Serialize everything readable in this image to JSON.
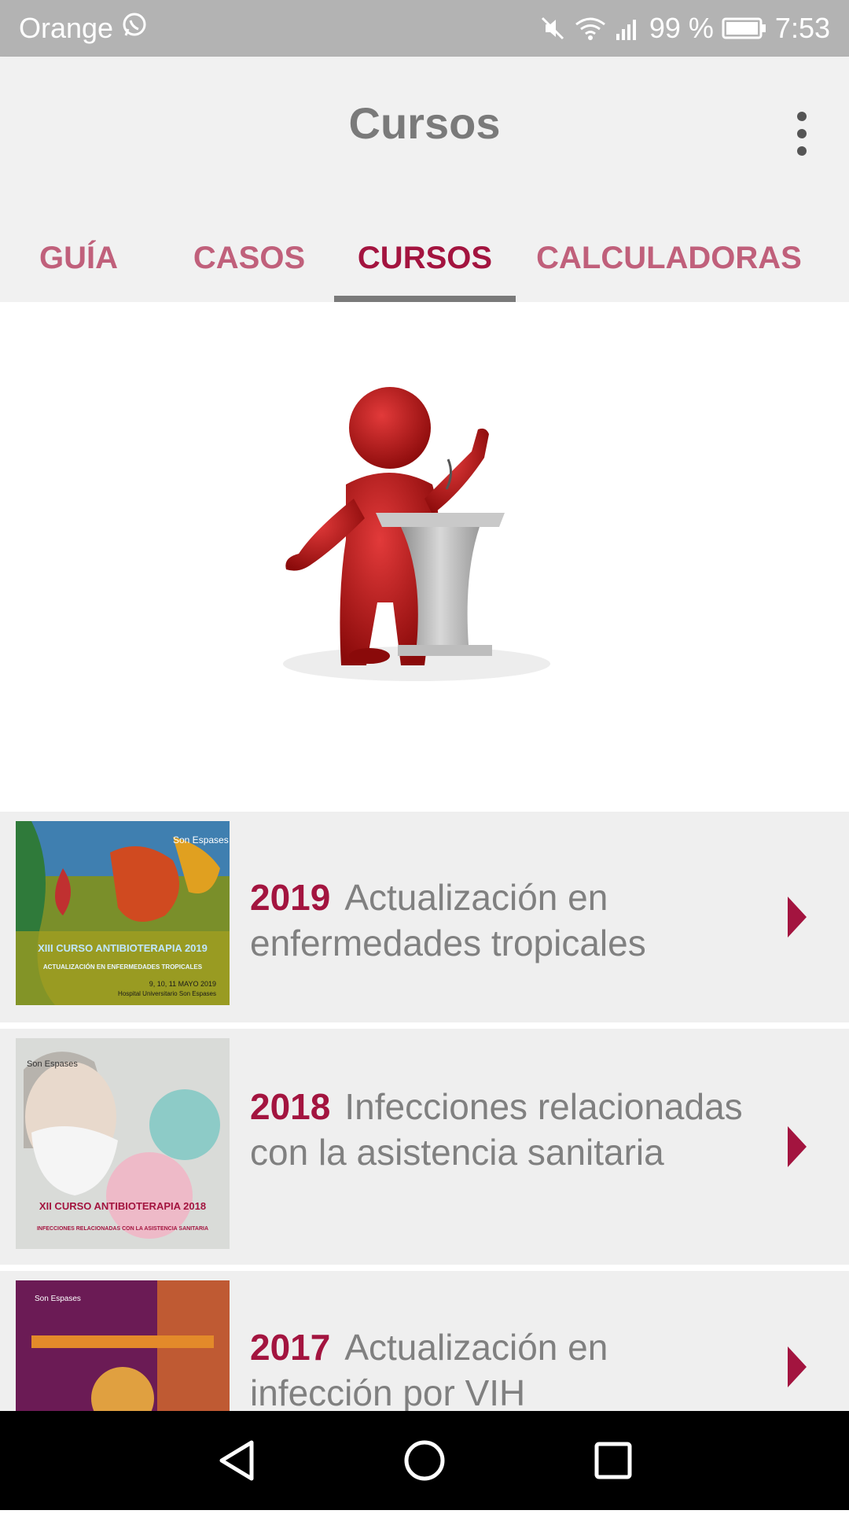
{
  "status_bar": {
    "carrier": "Orange",
    "battery": "99 %",
    "time": "7:53",
    "icons": [
      "whatsapp-icon",
      "mute-icon",
      "wifi-icon",
      "signal-icon",
      "battery-icon"
    ]
  },
  "app_bar": {
    "title": "Cursos",
    "menu_icon": "more-vert-icon"
  },
  "tabs": [
    {
      "label": "GUÍA",
      "active": false
    },
    {
      "label": "CASOS",
      "active": false
    },
    {
      "label": "CURSOS",
      "active": true
    },
    {
      "label": "CALCULADORAS",
      "active": false
    }
  ],
  "hero": {
    "icon": "presenter-at-podium-illustration"
  },
  "courses": [
    {
      "year": "2019",
      "title": "Actualización en enfermedades tropicales",
      "poster": {
        "brand": "Son Espases",
        "heading": "XIII CURSO ANTIBIOTERAPIA 2019",
        "subheading": "ACTUALIZACIÓN EN ENFERMEDADES TROPICALES",
        "dates": "9, 10, 11 MAYO 2019",
        "venue": "Hospital Universitario Son Espases"
      }
    },
    {
      "year": "2018",
      "title": "Infecciones relacionadas con la asistencia sanitaria",
      "poster": {
        "brand": "Son Espases",
        "heading": "XII CURSO ANTIBIOTERAPIA 2018",
        "subheading": "INFECCIONES RELACIONADAS CON LA ASISTENCIA SANITARIA"
      }
    },
    {
      "year": "2017",
      "title": "Actualización en infección por VIH",
      "poster": {
        "brand": "Son Espases"
      }
    }
  ],
  "nav_bar": {
    "back_icon": "back-triangle-icon",
    "home_icon": "home-circle-icon",
    "recents_icon": "recents-square-icon"
  },
  "colors": {
    "accent": "#a3143f",
    "tab_inactive": "#c0607b",
    "status_bar": "#b3b3b3",
    "app_bar": "#f1f1f1",
    "list_bg": "#efefef"
  }
}
